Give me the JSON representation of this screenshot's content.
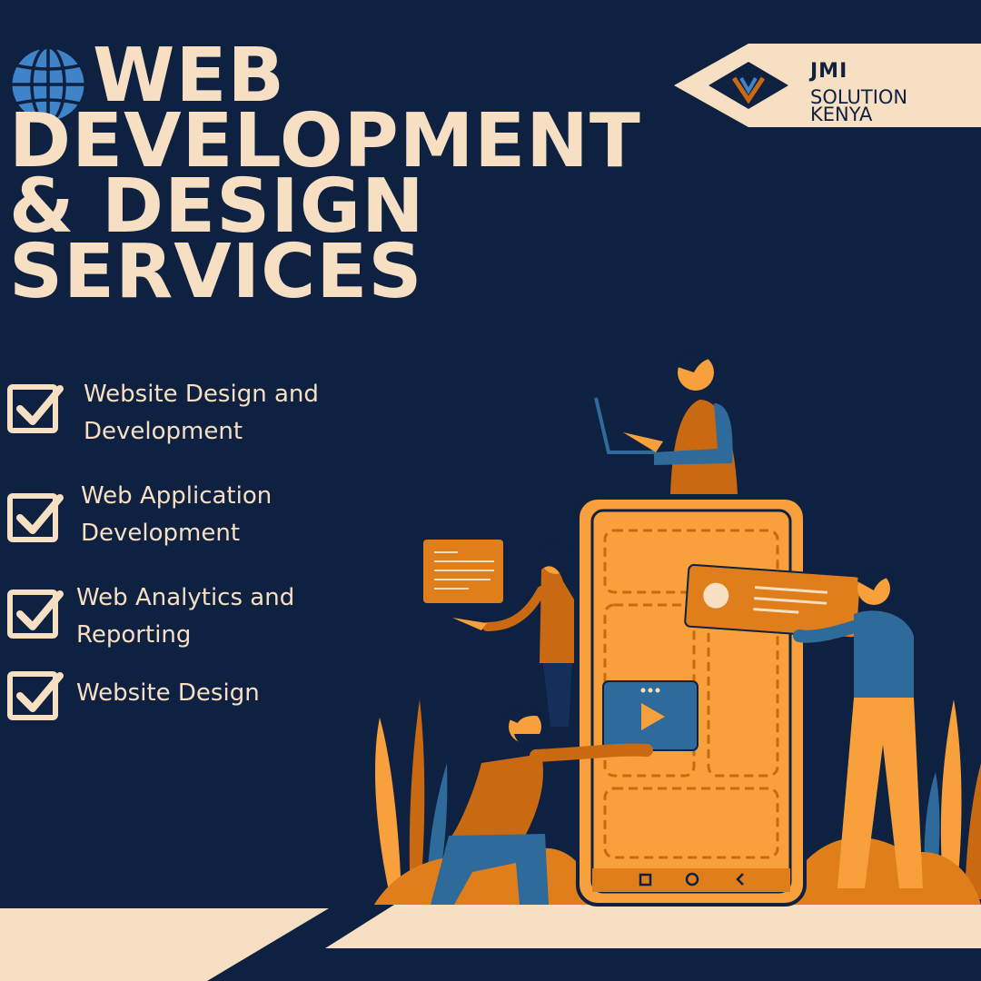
{
  "heading": {
    "line1": "WEB",
    "line2": "DEVELOPMENT",
    "line3": "& DESIGN",
    "line4": "SERVICES"
  },
  "brand": {
    "title": "JMI",
    "subtitle_line1": "SOLUTION",
    "subtitle_line2": "KENYA"
  },
  "services": [
    "Website Design and Development",
    "Web Application Development",
    "Web Analytics and Reporting",
    "Website Design"
  ],
  "icons": {
    "globe": "globe-icon",
    "check": "checkbox-checked-icon",
    "logo": "diamond-logo-icon"
  },
  "colors": {
    "background": "#0f2140",
    "cream": "#f6dfc2",
    "orange": "#f7a03c",
    "dark_orange": "#c96a12",
    "blue": "#2f6b9a"
  }
}
